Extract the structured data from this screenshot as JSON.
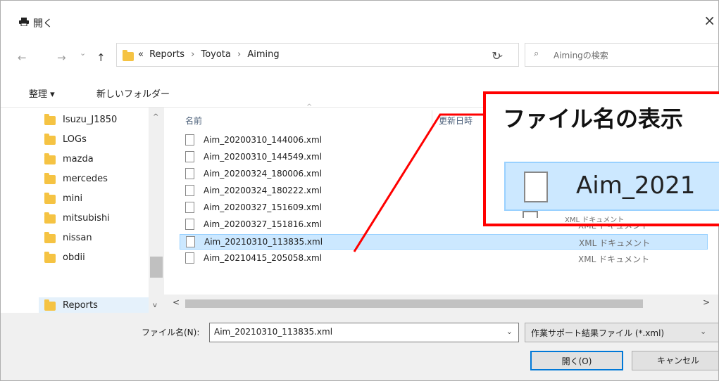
{
  "window": {
    "title": "開く",
    "close_glyph": "×"
  },
  "address": {
    "back_glyph": "←",
    "forward_glyph": "→",
    "recent_glyph": "⌄",
    "up_glyph": "↑",
    "breadcrumb_prefix": "«",
    "crumbs": [
      "Reports",
      "Toyota",
      "Aiming"
    ],
    "separator": "›",
    "dropdown_glyph": "⌄",
    "refresh_glyph": "↻",
    "search_placeholder": "Aimingの検索",
    "search_glyph": "⌕"
  },
  "toolbar": {
    "organize_label": "整理 ▾",
    "new_folder_label": "新しいフォルダー"
  },
  "sidebar": {
    "items": [
      {
        "label": "Isuzu_J1850"
      },
      {
        "label": "LOGs"
      },
      {
        "label": "mazda"
      },
      {
        "label": "mercedes"
      },
      {
        "label": "mini"
      },
      {
        "label": "mitsubishi"
      },
      {
        "label": "nissan"
      },
      {
        "label": "obdii"
      },
      {
        "label": "Reports",
        "selected": true
      }
    ],
    "scroll_up": "^",
    "scroll_down": "v"
  },
  "filelist": {
    "columns": {
      "name": "名前",
      "modified": "更新日時",
      "sort_glyph": "^"
    },
    "rows": [
      {
        "name": "Aim_20200310_144006.xml",
        "type": ""
      },
      {
        "name": "Aim_20200310_144549.xml",
        "type": ""
      },
      {
        "name": "Aim_20200324_180006.xml",
        "type": ""
      },
      {
        "name": "Aim_20200324_180222.xml",
        "type": ""
      },
      {
        "name": "Aim_20200327_151609.xml",
        "type": "XML ドキュメント"
      },
      {
        "name": "Aim_20200327_151816.xml",
        "type": "XML ドキュメント"
      },
      {
        "name": "Aim_20210310_113835.xml",
        "type": "XML ドキュメント",
        "selected": true
      },
      {
        "name": "Aim_20210415_205058.xml",
        "type": "XML ドキュメント"
      }
    ],
    "hscroll_left": "<",
    "hscroll_right": ">"
  },
  "bottom": {
    "filename_label": "ファイル名(N):",
    "filename_value": "Aim_20210310_113835.xml",
    "filename_drop": "⌄",
    "filetype_value": "作業サポート結果ファイル (*.xml)",
    "filetype_drop": "⌄",
    "open_button": "開く(O)",
    "cancel_button": "キャンセル"
  },
  "callout": {
    "title": "ファイル名の表示",
    "zoom_filename": "Aim_2021",
    "zoom_next_type": "XML ドキュメント",
    "border_color": "#ff0000"
  }
}
